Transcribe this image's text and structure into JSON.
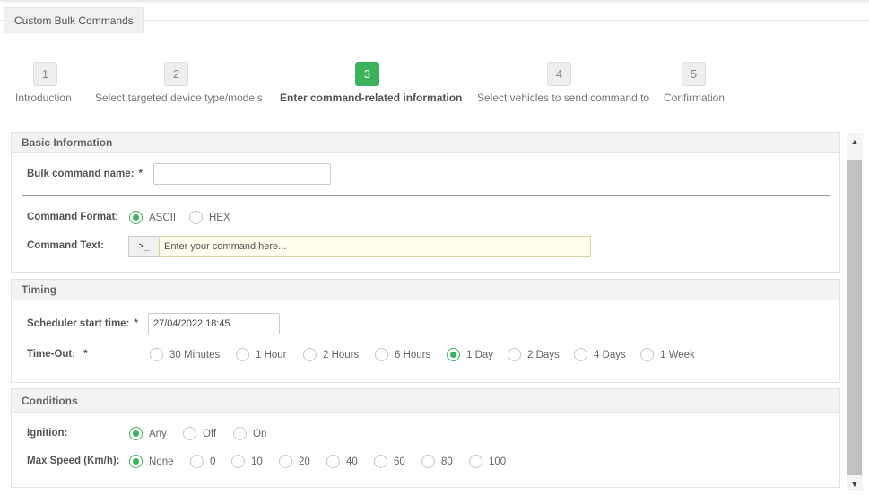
{
  "tab": {
    "label": "Custom Bulk Commands"
  },
  "wizard": {
    "steps": [
      {
        "num": "1",
        "label": "Introduction"
      },
      {
        "num": "2",
        "label": "Select targeted device type/models"
      },
      {
        "num": "3",
        "label": "Enter command-related information"
      },
      {
        "num": "4",
        "label": "Select vehicles to send command to"
      },
      {
        "num": "5",
        "label": "Confirmation"
      }
    ],
    "active_step": 3
  },
  "basic": {
    "title": "Basic Information",
    "name_label": "Bulk command name:",
    "required_mark": "*",
    "name_value": "",
    "format_label": "Command Format:",
    "format_options": [
      "ASCII",
      "HEX"
    ],
    "format_selected": "ASCII",
    "text_label": "Command Text:",
    "text_prefix": ">_",
    "text_placeholder": "Enter your command here..."
  },
  "timing": {
    "title": "Timing",
    "start_label": "Scheduler start time:",
    "start_value": "27/04/2022 18:45",
    "timeout_label": "Time-Out:",
    "timeout_options": [
      "30 Minutes",
      "1 Hour",
      "2 Hours",
      "6 Hours",
      "1 Day",
      "2 Days",
      "4 Days",
      "1 Week"
    ],
    "timeout_selected": "1 Day"
  },
  "conditions": {
    "title": "Conditions",
    "ignition_label": "Ignition:",
    "ignition_options": [
      "Any",
      "Off",
      "On"
    ],
    "ignition_selected": "Any",
    "speed_label": "Max Speed (Km/h):",
    "speed_options": [
      "None",
      "0",
      "10",
      "20",
      "40",
      "60",
      "80",
      "100"
    ],
    "speed_selected": "None"
  },
  "icons": {
    "scroll_up": "▲",
    "scroll_down": "▼"
  },
  "colors": {
    "accent": "#3cb35b"
  }
}
